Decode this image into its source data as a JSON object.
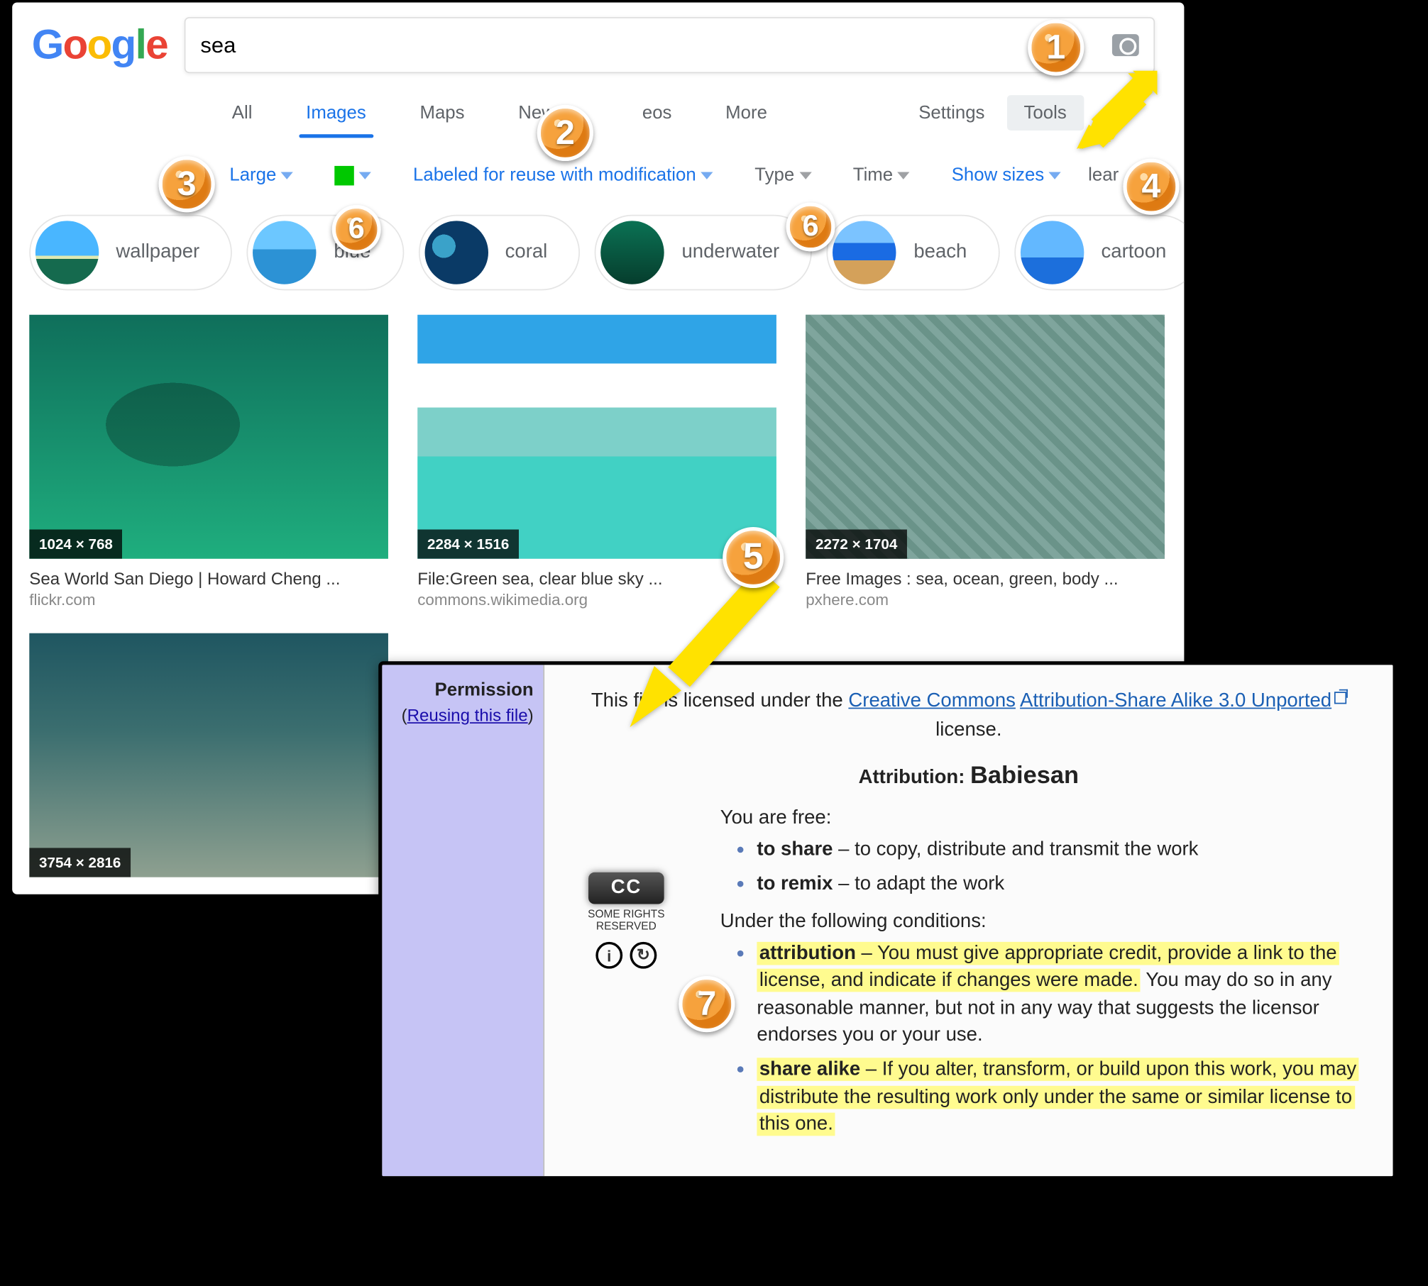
{
  "search": {
    "query": "sea"
  },
  "nav": {
    "all": "All",
    "images": "Images",
    "maps": "Maps",
    "news": "News",
    "videos_partial": "eos",
    "more": "More",
    "settings": "Settings",
    "tools": "Tools"
  },
  "filters": {
    "size": "Large",
    "license": "Labeled for reuse with modification",
    "type": "Type",
    "time": "Time",
    "show_sizes": "Show sizes",
    "clear_partial": "lear"
  },
  "chips": [
    "wallpaper",
    "blue",
    "coral",
    "underwater",
    "beach",
    "cartoon"
  ],
  "results": [
    {
      "dim": "1024 × 768",
      "title": "Sea World San Diego | Howard Cheng ...",
      "src": "flickr.com"
    },
    {
      "dim": "2284 × 1516",
      "title": "File:Green sea, clear blue sky ...",
      "src": "commons.wikimedia.org"
    },
    {
      "dim": "2272 × 1704",
      "title": "Free Images : sea, ocean, green, body ...",
      "src": "pxhere.com"
    },
    {
      "dim": "3754 × 2816"
    }
  ],
  "perm": {
    "header": "Permission",
    "reuse_pre": "(",
    "reuse_link": "Reusing this file",
    "reuse_post": ")",
    "line1": "This file is licensed under the ",
    "cc_link": "Creative Commons",
    "mid": " ",
    "asa_link": "Attribution-Share Alike 3.0 Unported",
    "line_end": " license.",
    "attr_label": "Attribution:",
    "attr_name": "Babiesan",
    "cc_label": "CC",
    "cc_rights": "SOME RIGHTS RESERVED",
    "by_icon": "i",
    "sa_icon": "↻",
    "free": "You are free:",
    "share_b": "to share",
    "share_t": " – to copy, distribute and transmit the work",
    "remix_b": "to remix",
    "remix_t": " – to adapt the work",
    "cond": "Under the following conditions:",
    "attr_b": "attribution",
    "attr_hl": " – You must give appropriate credit, provide a link to the license, and indicate if changes were made.",
    "attr_rest": " You may do so in any reasonable manner, but not in any way that suggests the licensor endorses you or your use.",
    "sa_b": "share alike",
    "sa_t": " – If you alter, transform, or build upon this work, you may distribute the resulting work only under the same or similar license to this one."
  },
  "badges": [
    "1",
    "2",
    "3",
    "4",
    "5",
    "6",
    "6",
    "7"
  ]
}
